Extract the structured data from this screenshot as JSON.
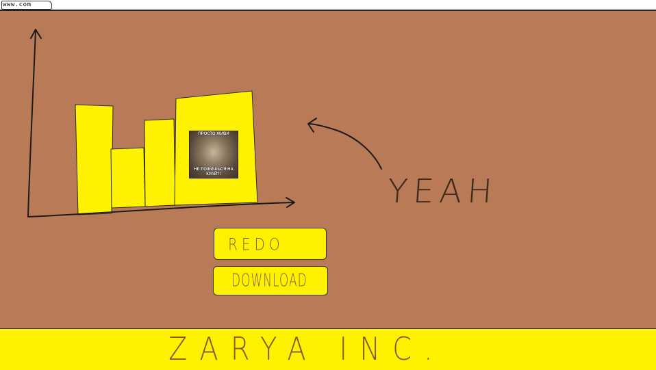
{
  "address_bar": {
    "url": "www.com"
  },
  "graphic": {
    "meme_caption_top": "ПРОСТО ЖИВИ",
    "meme_caption_bottom": "НЕ ЛОЖИШЬСЯ НА КРАЙ?!",
    "annotation": "YEAH"
  },
  "buttons": {
    "redo_label": "REDO",
    "download_label": "DOWNLOAD"
  },
  "footer": {
    "brand": "ZARYA INC."
  },
  "colors": {
    "background": "#b97b57",
    "accent_yellow": "#fff200",
    "text_brown": "#8a5a36"
  }
}
